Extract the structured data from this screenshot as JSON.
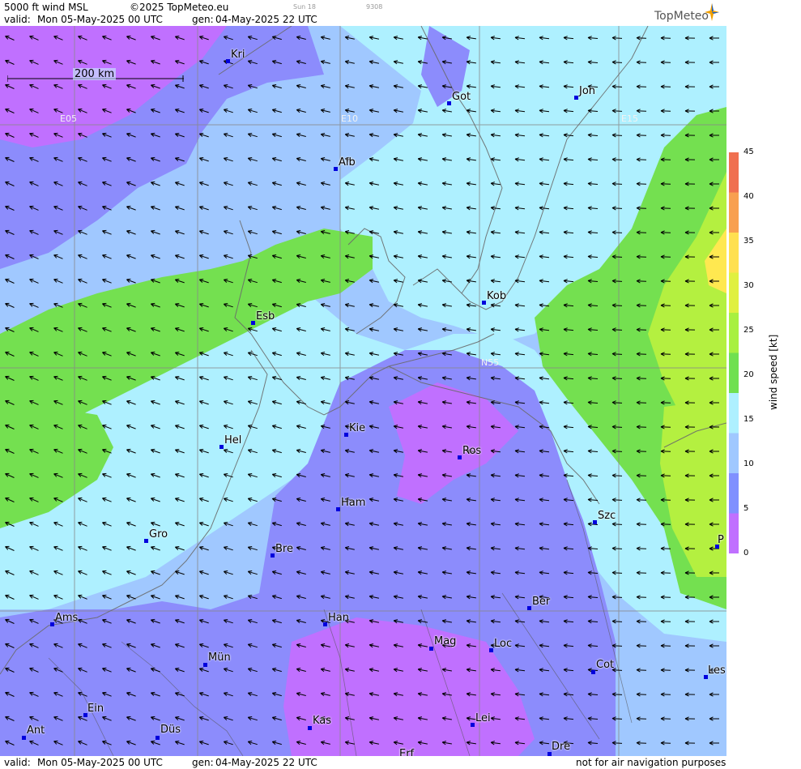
{
  "header": {
    "product": "5000 ft wind MSL",
    "copyright": "©2025 TopMeteo.eu",
    "valid_label": "valid:",
    "valid": "Mon  05-May-2025  00 UTC",
    "gen_label": "gen:",
    "gen": "04-May-2025 22 UTC",
    "small1": "Sun 18",
    "small2": "9308",
    "brand": "TopMeteo"
  },
  "footer": {
    "valid_label": "valid:",
    "valid": "Mon  05-May-2025  00 UTC",
    "gen_label": "gen:",
    "gen": "04-May-2025 22 UTC",
    "disclaimer": "not for air navigation purposes"
  },
  "scale": {
    "label": "200 km"
  },
  "grid_labels": {
    "e05": "E05",
    "e10": "E10",
    "e15": "E15",
    "n55": "N55"
  },
  "cities": [
    {
      "code": "Kri"
    },
    {
      "code": "Got"
    },
    {
      "code": "Jon"
    },
    {
      "code": "Alb"
    },
    {
      "code": "Esb"
    },
    {
      "code": "Kob"
    },
    {
      "code": "Kie"
    },
    {
      "code": "Hel"
    },
    {
      "code": "Ros"
    },
    {
      "code": "Ham"
    },
    {
      "code": "Szc"
    },
    {
      "code": "Gro"
    },
    {
      "code": "Bre"
    },
    {
      "code": "P"
    },
    {
      "code": "Ams"
    },
    {
      "code": "Han"
    },
    {
      "code": "Ber"
    },
    {
      "code": "Mag"
    },
    {
      "code": "Loc"
    },
    {
      "code": "Mün"
    },
    {
      "code": "Cot"
    },
    {
      "code": "Les"
    },
    {
      "code": "Ein"
    },
    {
      "code": "Kas"
    },
    {
      "code": "Lei"
    },
    {
      "code": "Ant"
    },
    {
      "code": "Düs"
    },
    {
      "code": "Dre"
    },
    {
      "code": "Erf"
    }
  ],
  "legend": {
    "unit": "wind speed [kt]",
    "ticks": [
      "45",
      "40",
      "35",
      "30",
      "25",
      "20",
      "15",
      "10",
      "5",
      "0"
    ],
    "colors": [
      "#f07050",
      "#f8a050",
      "#ffe050",
      "#e0f040",
      "#a8f040",
      "#70e050",
      "#aef0ff",
      "#a0c8ff",
      "#8090ff",
      "#c070ff"
    ]
  },
  "colors": {
    "calm_purple": "#c070ff",
    "light_violet": "#8c8cfc",
    "periwinkle": "#a0c8ff",
    "cyan": "#aef0ff",
    "green": "#74e050",
    "yellow_green": "#b4f040",
    "yellow": "#ffe850",
    "city_marker": "#0000dd"
  }
}
